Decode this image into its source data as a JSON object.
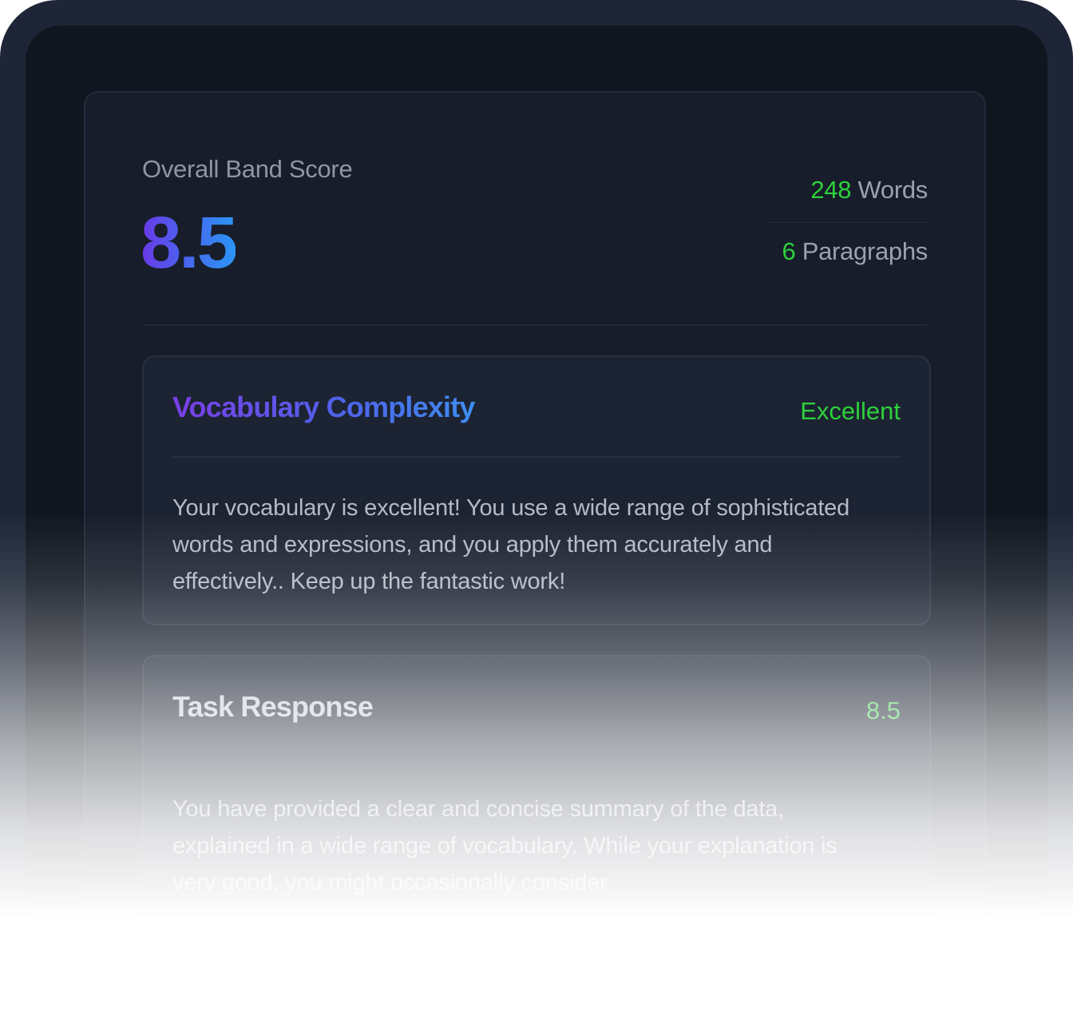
{
  "overview": {
    "score_label": "Overall Band Score",
    "score_value": "8.5",
    "words_count": "248",
    "words_unit": " Words",
    "paragraphs_count": "6",
    "paragraphs_unit": " Paragraphs"
  },
  "cards": [
    {
      "title": "Vocabulary Complexity",
      "badge": "Excellent",
      "body": "Your vocabulary is excellent!  You use a wide range of sophisticated words and expressions, and you apply them accurately and effectively..  Keep up the fantastic work!"
    },
    {
      "title": "Task Response",
      "badge": "8.5",
      "body": "You have provided a clear and concise summary of the data, explained in a wide range of vocabulary. While your explanation is very good, you might occasionally consider"
    }
  ],
  "colors": {
    "frame": "#1d2536",
    "screen": "#10151f",
    "panel": "#171d2a",
    "accent_green": "#2ed03c",
    "gradient_purple": "#6a39e8",
    "gradient_blue": "#2a96f4"
  }
}
